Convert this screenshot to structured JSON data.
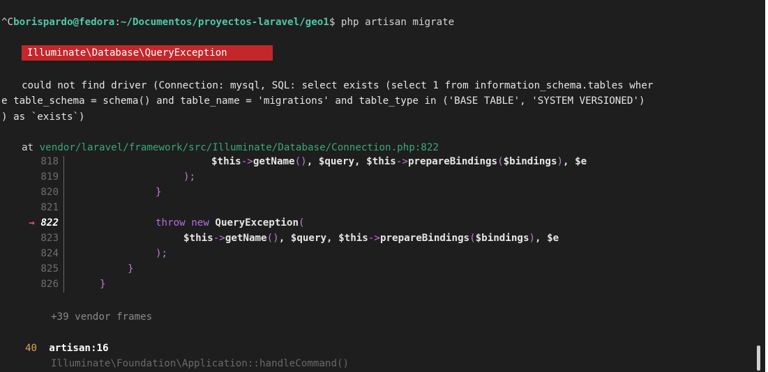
{
  "prompt": {
    "ctrl": "^C",
    "user_host": "borispardo@fedora",
    "colon": ":",
    "path": "~/Documentos/proyectos-laravel/geo1",
    "dollar": "$",
    "command": " php artisan migrate"
  },
  "exception": {
    "class": "Illuminate\\Database\\QueryException"
  },
  "message": {
    "line1": "could not find driver (Connection: mysql, SQL: select exists (select 1 from information_schema.tables wher",
    "line2": "e table_schema = schema() and table_name = 'migrations' and table_type in ('BASE TABLE', 'SYSTEM VERSIONED')",
    "line3": ") as `exists`)"
  },
  "location": {
    "at": "at ",
    "file": "vendor/laravel/framework/src/Illuminate/Database/Connection.php",
    "sep": ":",
    "line": "822"
  },
  "snippet": {
    "arrow": "→",
    "line_numbers": [
      "818",
      "819",
      "820",
      "821",
      "822",
      "823",
      "824",
      "825",
      "826"
    ],
    "current_line": "822",
    "tokens": {
      "this1": "$this",
      "arrow_op": "->",
      "getName": "getName",
      "paren_empty": "()",
      "comma": ", ",
      "query": "$query",
      "prepareBindings": "prepareBindings",
      "open_paren": "(",
      "bindings": "$bindings",
      "close_paren": ")",
      "e": "$e",
      "close_stmt": ");",
      "close_brace": "}",
      "throw_new": "throw new ",
      "QueryException": "QueryException"
    }
  },
  "trace": {
    "vendor_frames": "+39 vendor frames",
    "frame_number": "40",
    "frame_file": "artisan:16",
    "frame_call": "Illuminate\\Foundation\\Application::handleCommand()"
  }
}
